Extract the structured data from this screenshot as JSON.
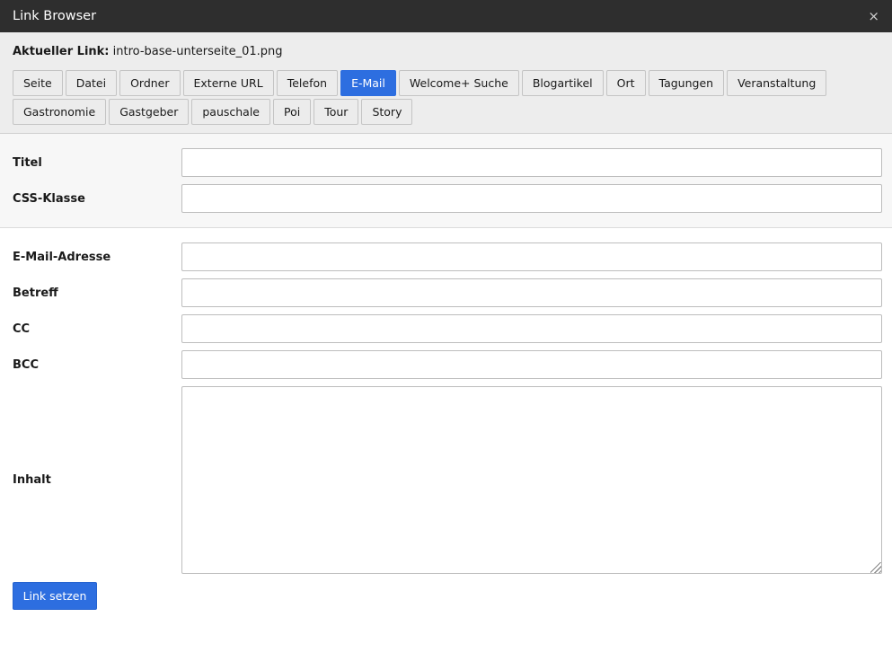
{
  "window": {
    "title": "Link Browser",
    "close_glyph": "×"
  },
  "current_link": {
    "label": "Aktueller Link:",
    "value": "intro-base-unterseite_01.png"
  },
  "tabs": {
    "row1": [
      "Seite",
      "Datei",
      "Ordner",
      "Externe URL",
      "Telefon",
      "E-Mail",
      "Welcome+ Suche",
      "Blogartikel",
      "Ort",
      "Tagungen",
      "Veranstaltung"
    ],
    "row2": [
      "Gastronomie",
      "Gastgeber",
      "pauschale",
      "Poi",
      "Tour",
      "Story"
    ],
    "active": "E-Mail"
  },
  "general_fields": {
    "title": {
      "label": "Titel",
      "value": ""
    },
    "css_class": {
      "label": "CSS-Klasse",
      "value": ""
    }
  },
  "email_fields": {
    "address": {
      "label": "E-Mail-Adresse",
      "value": ""
    },
    "subject": {
      "label": "Betreff",
      "value": ""
    },
    "cc": {
      "label": "CC",
      "value": ""
    },
    "bcc": {
      "label": "BCC",
      "value": ""
    },
    "body": {
      "label": "Inhalt",
      "value": ""
    }
  },
  "submit_label": "Link setzen",
  "colors": {
    "accent": "#2d6ee0",
    "titlebar": "#2e2e2e",
    "panel": "#ededed"
  },
  "icons": {
    "close": "close-icon",
    "resize": "resize-grip-icon"
  }
}
